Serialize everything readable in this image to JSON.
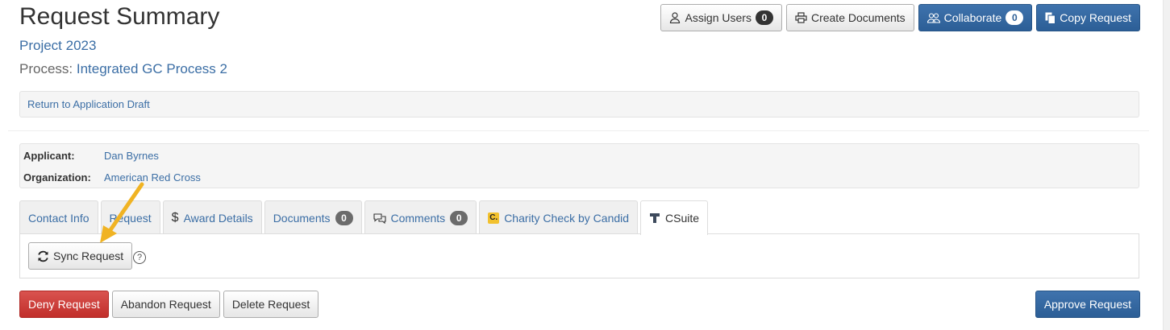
{
  "header": {
    "title": "Request Summary",
    "project": "Project 2023",
    "process_label": "Process:",
    "process_name": "Integrated GC Process 2"
  },
  "top_actions": {
    "assign_users": "Assign Users",
    "assign_users_count": "0",
    "create_documents": "Create Documents",
    "collaborate": "Collaborate",
    "collaborate_count": "0",
    "copy_request": "Copy Request"
  },
  "draft": {
    "link": "Return to Application Draft"
  },
  "applicant": {
    "applicant_label": "Applicant:",
    "applicant_value": "Dan Byrnes",
    "org_label": "Organization:",
    "org_value": "American Red Cross"
  },
  "tabs": [
    {
      "label": "Contact Info"
    },
    {
      "label": "Request"
    },
    {
      "label": "Award Details",
      "icon": "dollar-icon"
    },
    {
      "label": "Documents",
      "count": "0"
    },
    {
      "label": "Comments",
      "count": "0",
      "icon": "comments-icon"
    },
    {
      "label": "Charity Check by Candid",
      "icon": "candid-icon",
      "icon_text": "C."
    },
    {
      "label": "CSuite",
      "icon": "csuite-icon",
      "active": true
    }
  ],
  "panel": {
    "sync_button": "Sync Request",
    "help_glyph": "?"
  },
  "bottom_actions": {
    "deny": "Deny Request",
    "abandon": "Abandon Request",
    "delete": "Delete Request",
    "approve": "Approve Request"
  },
  "colors": {
    "primary": "#2c5e96",
    "danger": "#c9302c",
    "link": "#3b6ea5",
    "annotation_arrow": "#f0b323"
  }
}
